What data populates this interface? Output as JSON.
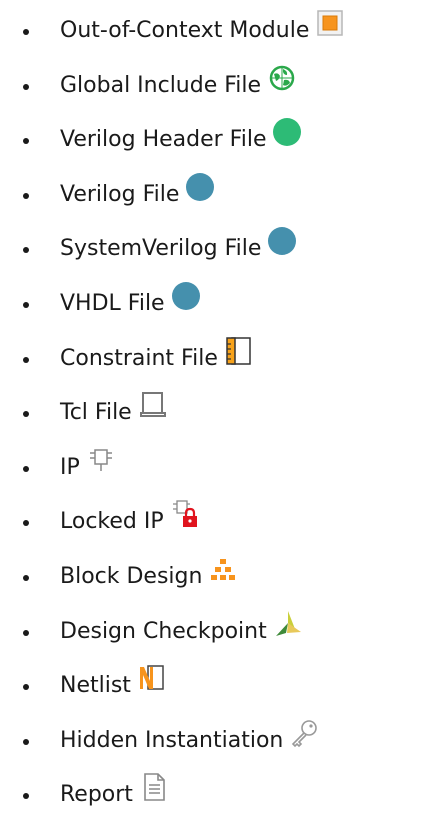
{
  "items": [
    {
      "label": "Out-of-Context Module",
      "icon": "ooc-module-icon"
    },
    {
      "label": "Global Include File",
      "icon": "global-include-icon"
    },
    {
      "label": "Verilog Header File",
      "icon": "green-dot-icon"
    },
    {
      "label": "Verilog File",
      "icon": "blue-dot-icon"
    },
    {
      "label": "SystemVerilog File",
      "icon": "blue-dot-icon"
    },
    {
      "label": "VHDL File",
      "icon": "blue-dot-icon"
    },
    {
      "label": "Constraint File",
      "icon": "constraint-file-icon"
    },
    {
      "label": "Tcl File",
      "icon": "tcl-file-icon"
    },
    {
      "label": "IP",
      "icon": "ip-icon"
    },
    {
      "label": "Locked IP",
      "icon": "locked-ip-icon"
    },
    {
      "label": "Block Design",
      "icon": "block-design-icon"
    },
    {
      "label": "Design Checkpoint",
      "icon": "design-checkpoint-icon"
    },
    {
      "label": "Netlist",
      "icon": "netlist-icon"
    },
    {
      "label": "Hidden Instantiation",
      "icon": "key-icon"
    },
    {
      "label": "Report",
      "icon": "report-icon"
    }
  ],
  "colors": {
    "verilog_header": "#2dbb76",
    "hdl_blue": "#4590ad",
    "orange": "#f7941d",
    "lock_red": "#e0141e"
  }
}
